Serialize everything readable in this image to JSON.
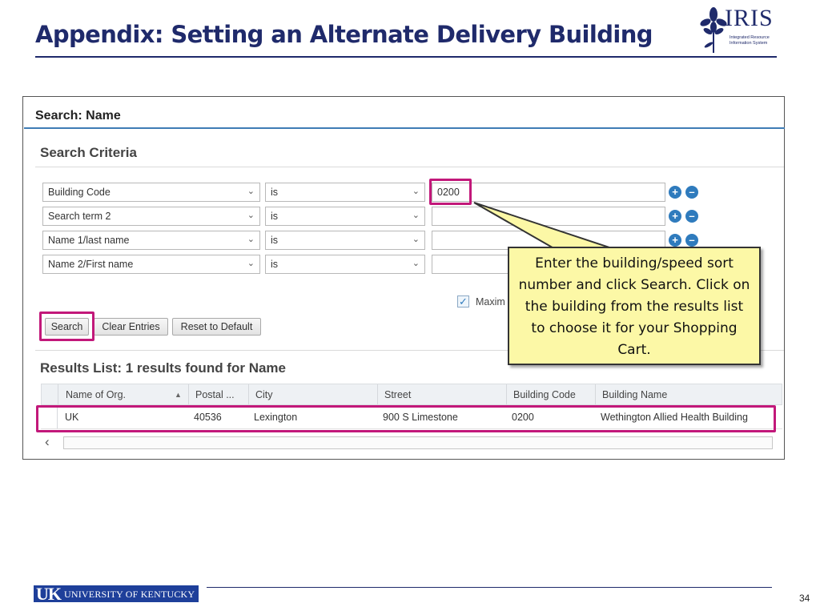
{
  "slide": {
    "title": "Appendix: Setting an Alternate Delivery Building",
    "page_number": "34"
  },
  "logo": {
    "word": "IRIS",
    "subtitle_line1": "Integrated Resource",
    "subtitle_line2": "Information System"
  },
  "footer": {
    "uk_mark": "UK",
    "university_name": "UNIVERSITY OF KENTUCKY"
  },
  "panel": {
    "header": "Search: Name",
    "criteria_title": "Search Criteria",
    "rows": [
      {
        "field": "Building Code",
        "operator": "is",
        "value": "0200"
      },
      {
        "field": "Search term 2",
        "operator": "is",
        "value": ""
      },
      {
        "field": "Name 1/last name",
        "operator": "is",
        "value": ""
      },
      {
        "field": "Name 2/First name",
        "operator": "is",
        "value": ""
      }
    ],
    "max_hits_label": "Maxim",
    "max_hits_checked": true,
    "buttons": {
      "search": "Search",
      "clear": "Clear Entries",
      "reset": "Reset to Default"
    },
    "results_title": "Results List: 1 results found for Name",
    "columns": [
      "Name of Org.",
      "Postal ...",
      "City",
      "Street",
      "Building Code",
      "Building Name"
    ],
    "results": [
      {
        "name_of_org": "UK",
        "postal": "40536",
        "city": "Lexington",
        "street": "900 S Limestone",
        "building_code": "0200",
        "building_name": "Wethington Allied Health Building"
      }
    ]
  },
  "callout": {
    "text": "Enter the building/speed sort number and click Search. Click on the building from the results list to choose it for your Shopping Cart."
  },
  "colors": {
    "title_navy": "#1f2a6b",
    "highlight_magenta": "#c2187a",
    "callout_yellow": "#fcf8a6",
    "sap_blue": "#3f7cb5",
    "uk_blue": "#1e3f9a"
  },
  "icons": {
    "add_row": "plus-circle-icon",
    "remove_row": "minus-circle-icon",
    "dropdown": "chevron-down-icon",
    "sort": "sort-ascending-icon",
    "scroll": "chevron-left-icon"
  }
}
